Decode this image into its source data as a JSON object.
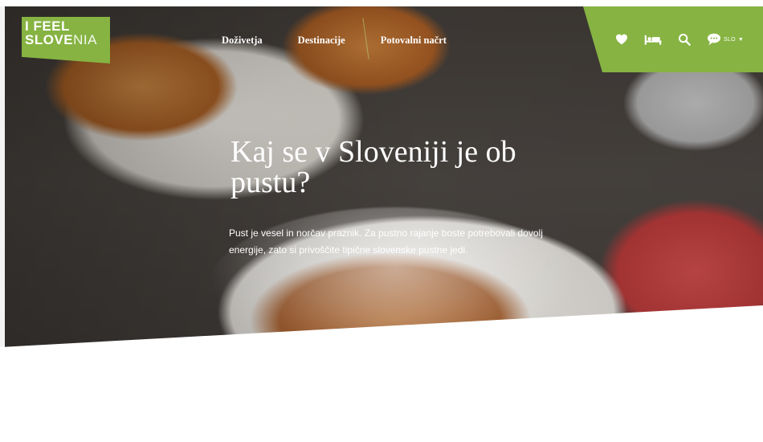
{
  "logo": {
    "line1": "I FEEL",
    "line2_bold": "SLOVE",
    "line2_light": "NIA"
  },
  "nav": {
    "items": [
      {
        "label": "Doživetja"
      },
      {
        "label": "Destinacije"
      },
      {
        "label": "Potovalni načrt"
      }
    ]
  },
  "utility": {
    "icons": [
      "heart-icon",
      "bed-icon",
      "search-icon",
      "chat-icon"
    ],
    "language": "SLO",
    "accent_color": "#86b342"
  },
  "hero": {
    "title": "Kaj se v Sloveniji je ob pustu?",
    "description": "Pust je vesel in norčav praznik. Za pustno rajanje boste potrebovali dovolj energije, zato si privoščite tipične slovenske pustne jedi."
  }
}
